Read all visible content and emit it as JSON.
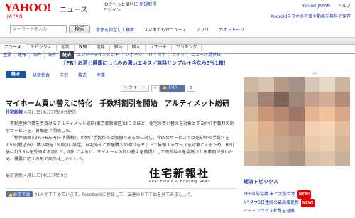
{
  "header": {
    "logo_main": "YAHOO!",
    "logo_sub": "JAPAN",
    "title": "ニュース",
    "signin_prompt": "IDでもっと便利に",
    "signup_link": "新規取得",
    "login_link": "ログイン",
    "right_links": [
      "Yahoo! JAPAN",
      "ヘルプ"
    ],
    "android_notice": "Androidスマホの写真や動画を無料で保存"
  },
  "search": {
    "placeholder": "キーワードを入力",
    "button_label": "検索",
    "links": [
      "条件を指定して検索",
      "スマホでもY!ニュース",
      "アプリ",
      "カオトトーク"
    ]
  },
  "nav_main": [
    "ニュース",
    "トピックス",
    "写真",
    "映像",
    "地域",
    "雑誌",
    "個人",
    "リサーチ",
    "ランキング"
  ],
  "nav_sub": [
    "主要",
    "速報",
    "国内",
    "海外",
    "経済",
    "エンターテインメント",
    "スポーツ",
    "IT・科学",
    "ライフ",
    "ニュース提供社"
  ],
  "pr_banner": "[PR] お酒と健康にしじみの濃いエキス／無料サンプル＋今なら5％1箱！",
  "section": {
    "tab": "経済",
    "links": [
      "経済総合",
      "市況",
      "株式",
      "産業"
    ]
  },
  "ad_label": "PR",
  "share": {
    "tweet_label": "ツイート",
    "tweet_count": "0",
    "like_label": "いいね！",
    "like_count": "0"
  },
  "article": {
    "title": "マイホーム買い替えに特化　手数料割引を開始　アルティメット総研",
    "source": "住宅新報",
    "date": "4月11日(木)17時59分配信",
    "paragraphs": [
      "不動産仲介業を手掛けるアルティメット総研(東京都新宿区)はこのほど、住宅の買い替えを対象とする仲介手数料の割引サービスを、首都圏で開始した。",
      "「物件価格×3%+6万円(+消費税)」が仲介手数料の上限額であるのに対し、今回のサービスでは売却時の手数料を2.5%(税込み)、購入時を1%(同)に設定。自宅売却と新居購入の仲介をセットで依頼するケースを対象とするため、割引後は計3.5%を受領する流れだ。同社によると、マイホームの買い替えを前提として売却仲介を委託される事例が多いため、需要に応える形で商品化したという。"
    ],
    "updated": "最終更新:4月11日(木)17時59分",
    "publisher_logo_jp": "住宅新報社",
    "publisher_logo_en": "Real Estate & Housing News",
    "bottom_like": "おすすめ",
    "bottom_text": "41人がすすめています。Facebookに登録して、友達のおすすめを見てみましょう。"
  },
  "topics": {
    "heading": "経済トピックス",
    "new_label": "NEW!",
    "items": [
      "TPP事前協議 米と大筋合意",
      "NYダウ3日連続の最高値更新",
      "イー・アクセス社員を退職"
    ]
  },
  "colors": {
    "brand": "#e00",
    "link": "#1a3da8",
    "section_tab": "#1a55a0",
    "selected_nav": "#345",
    "facebook": "#5872a8"
  }
}
